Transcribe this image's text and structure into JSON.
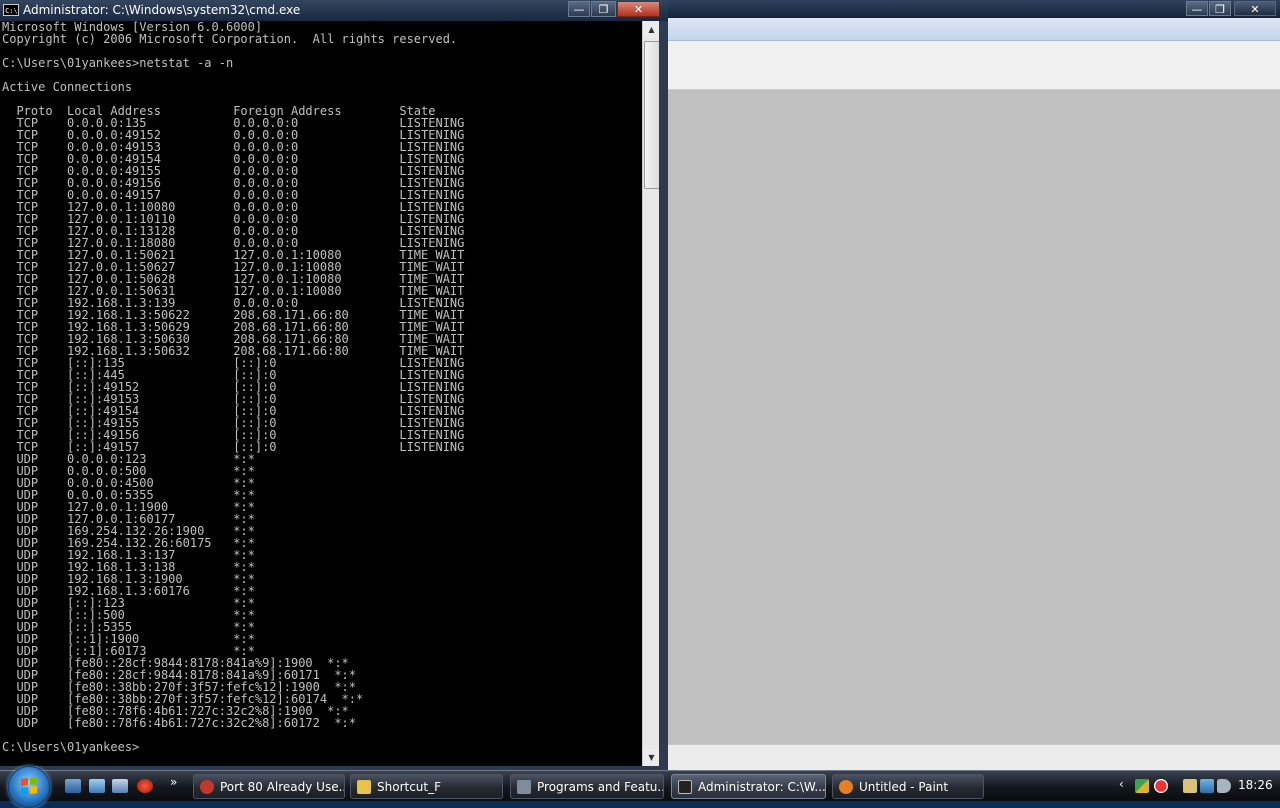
{
  "cmd": {
    "title": "Administrator: C:\\Windows\\system32\\cmd.exe",
    "icon_text": "C:\\.",
    "buttons": {
      "minimize": "—",
      "maximize": "❐",
      "close": "✕"
    },
    "lines": [
      "Microsoft Windows [Version 6.0.6000]",
      "Copyright (c) 2006 Microsoft Corporation.  All rights reserved.",
      "",
      "C:\\Users\\01yankees>netstat -a -n",
      "",
      "Active Connections",
      "",
      "  Proto  Local Address          Foreign Address        State",
      "  TCP    0.0.0.0:135            0.0.0.0:0              LISTENING",
      "  TCP    0.0.0.0:49152          0.0.0.0:0              LISTENING",
      "  TCP    0.0.0.0:49153          0.0.0.0:0              LISTENING",
      "  TCP    0.0.0.0:49154          0.0.0.0:0              LISTENING",
      "  TCP    0.0.0.0:49155          0.0.0.0:0              LISTENING",
      "  TCP    0.0.0.0:49156          0.0.0.0:0              LISTENING",
      "  TCP    0.0.0.0:49157          0.0.0.0:0              LISTENING",
      "  TCP    127.0.0.1:10080        0.0.0.0:0              LISTENING",
      "  TCP    127.0.0.1:10110        0.0.0.0:0              LISTENING",
      "  TCP    127.0.0.1:13128        0.0.0.0:0              LISTENING",
      "  TCP    127.0.0.1:18080        0.0.0.0:0              LISTENING",
      "  TCP    127.0.0.1:50621        127.0.0.1:10080        TIME_WAIT",
      "  TCP    127.0.0.1:50627        127.0.0.1:10080        TIME_WAIT",
      "  TCP    127.0.0.1:50628        127.0.0.1:10080        TIME_WAIT",
      "  TCP    127.0.0.1:50631        127.0.0.1:10080        TIME_WAIT",
      "  TCP    192.168.1.3:139        0.0.0.0:0              LISTENING",
      "  TCP    192.168.1.3:50622      208.68.171.66:80       TIME_WAIT",
      "  TCP    192.168.1.3:50629      208.68.171.66:80       TIME_WAIT",
      "  TCP    192.168.1.3:50630      208.68.171.66:80       TIME_WAIT",
      "  TCP    192.168.1.3:50632      208.68.171.66:80       TIME_WAIT",
      "  TCP    [::]:135               [::]:0                 LISTENING",
      "  TCP    [::]:445               [::]:0                 LISTENING",
      "  TCP    [::]:49152             [::]:0                 LISTENING",
      "  TCP    [::]:49153             [::]:0                 LISTENING",
      "  TCP    [::]:49154             [::]:0                 LISTENING",
      "  TCP    [::]:49155             [::]:0                 LISTENING",
      "  TCP    [::]:49156             [::]:0                 LISTENING",
      "  TCP    [::]:49157             [::]:0                 LISTENING",
      "  UDP    0.0.0.0:123            *:*",
      "  UDP    0.0.0.0:500            *:*",
      "  UDP    0.0.0.0:4500           *:*",
      "  UDP    0.0.0.0:5355           *:*",
      "  UDP    127.0.0.1:1900         *:*",
      "  UDP    127.0.0.1:60177        *:*",
      "  UDP    169.254.132.26:1900    *:*",
      "  UDP    169.254.132.26:60175   *:*",
      "  UDP    192.168.1.3:137        *:*",
      "  UDP    192.168.1.3:138        *:*",
      "  UDP    192.168.1.3:1900       *:*",
      "  UDP    192.168.1.3:60176      *:*",
      "  UDP    [::]:123               *:*",
      "  UDP    [::]:500               *:*",
      "  UDP    [::]:5355              *:*",
      "  UDP    [::1]:1900             *:*",
      "  UDP    [::1]:60173            *:*",
      "  UDP    [fe80::28cf:9844:8178:841a%9]:1900  *:*",
      "  UDP    [fe80::28cf:9844:8178:841a%9]:60171  *:*",
      "  UDP    [fe80::38bb:270f:3f57:fefc%12]:1900  *:*",
      "  UDP    [fe80::38bb:270f:3f57:fefc%12]:60174  *:*",
      "  UDP    [fe80::78f6:4b61:727c:32c2%8]:1900  *:*",
      "  UDP    [fe80::78f6:4b61:727c:32c2%8]:60172  *:*",
      "",
      "C:\\Users\\01yankees>"
    ],
    "scrollbar": {
      "up": "▲",
      "down": "▼"
    }
  },
  "paint": {
    "buttons": {
      "minimize": "—",
      "maximize": "❐",
      "close": "✕"
    }
  },
  "taskbar": {
    "quicklaunch_chevron": "»",
    "tasks": [
      {
        "label": "Port 80 Already Use...",
        "icon_color": "#c0392b"
      },
      {
        "label": "Shortcut_F",
        "icon_color": "#e8c34a"
      },
      {
        "label": "Programs and Featu...",
        "icon_color": "#7f8c9a"
      },
      {
        "label": "Administrator: C:\\W...",
        "icon_color": "#222222"
      },
      {
        "label": "Untitled - Paint",
        "icon_color": "#e67e22"
      }
    ],
    "tray_chevron": "‹",
    "clock": "18:26"
  },
  "colors": {
    "console_bg": "#000000",
    "console_text": "#c0c0c0",
    "paint_canvas_bg": "#c0c0c0"
  }
}
